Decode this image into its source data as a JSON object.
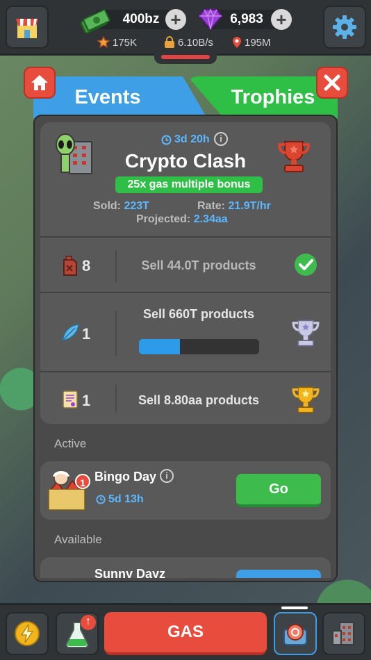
{
  "currency": {
    "cash": "400bz",
    "gems": "6,983"
  },
  "stats": {
    "rating": "175K",
    "rate": "6.10B/s",
    "location": "195M"
  },
  "tabs": {
    "events": "Events",
    "trophies": "Trophies"
  },
  "event": {
    "timer": "3d 20h",
    "title": "Crypto Clash",
    "bonus": "25x gas multiple bonus",
    "sold_label": "Sold:",
    "sold_value": "223T",
    "rate_label": "Rate:",
    "rate_value": "21.9T/hr",
    "projected_label": "Projected:",
    "projected_value": "2.34aa",
    "tasks": [
      {
        "reward_count": "8",
        "text": "Sell 44.0T products",
        "progress": 1.0,
        "done": true
      },
      {
        "reward_count": "1",
        "text": "Sell 660T products",
        "progress": 0.34,
        "done": false
      },
      {
        "reward_count": "1",
        "text": "Sell 8.80aa products",
        "progress": 0.0,
        "done": false
      }
    ]
  },
  "sections": {
    "active": "Active",
    "available": "Available"
  },
  "active_event": {
    "name": "Bingo Day",
    "timer": "5d 13h",
    "badge": "1",
    "button": "Go"
  },
  "available_event": {
    "name": "Sunny Dayz"
  },
  "bottom": {
    "gas_label": "GAS"
  },
  "colors": {
    "accent_red": "#e74c3c",
    "go_green": "#3dbb4d",
    "events_tab": "#3e9fe6",
    "trophies_tab": "#2fbf47",
    "link_blue": "#5cb8ff"
  },
  "icons": [
    "shop-icon",
    "cash-icon",
    "gem-icon",
    "gear-icon",
    "star-icon",
    "lock-bag-icon",
    "pin-icon",
    "home-icon",
    "close-icon",
    "alien-building-icon",
    "trophy-icon",
    "fuel-can-icon",
    "feather-icon",
    "scroll-icon",
    "check-icon",
    "info-icon",
    "clock-icon",
    "lightning-icon",
    "flask-icon",
    "vault-icon",
    "building-icon"
  ]
}
